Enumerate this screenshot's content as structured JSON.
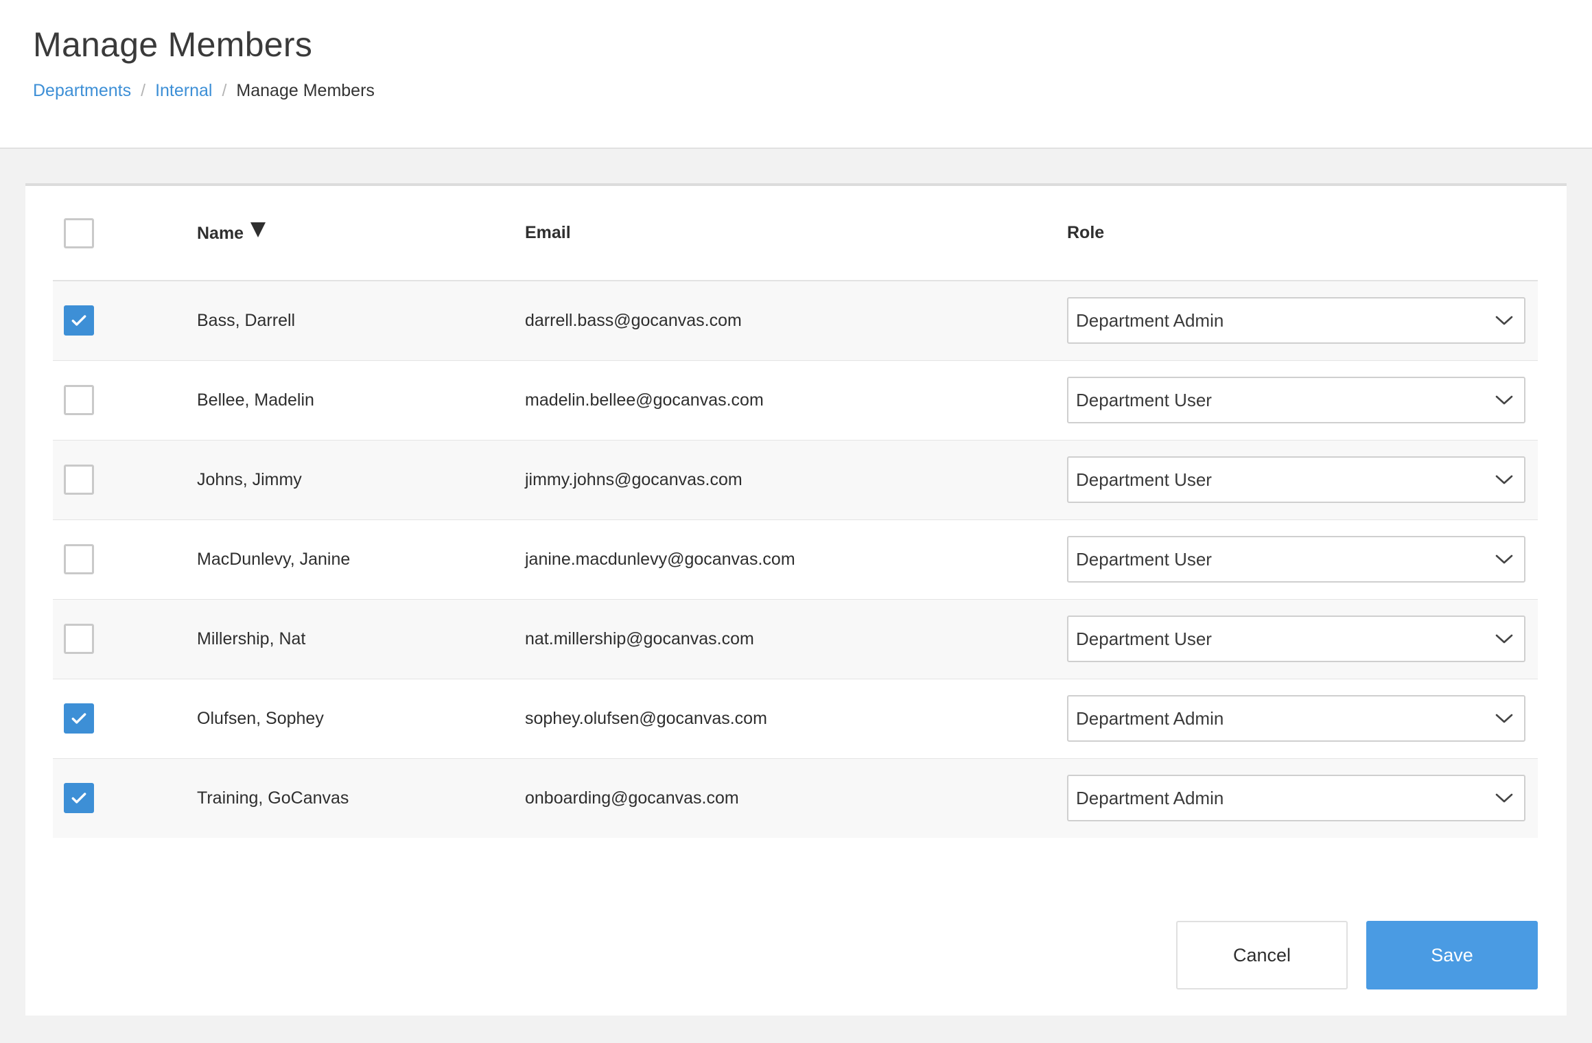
{
  "header": {
    "title": "Manage Members",
    "breadcrumb": [
      "Departments",
      "Internal",
      "Manage Members"
    ],
    "breadcrumb_separator": "/"
  },
  "table": {
    "columns": [
      "Name",
      "Email",
      "Role"
    ],
    "sorted_by": "Name",
    "select_all_checked": false,
    "rows": [
      {
        "checked": true,
        "name": "Bass, Darrell",
        "email": "darrell.bass@gocanvas.com",
        "role": "Department Admin"
      },
      {
        "checked": false,
        "name": "Bellee, Madelin",
        "email": "madelin.bellee@gocanvas.com",
        "role": "Department User"
      },
      {
        "checked": false,
        "name": "Johns, Jimmy",
        "email": "jimmy.johns@gocanvas.com",
        "role": "Department User"
      },
      {
        "checked": false,
        "name": "MacDunlevy, Janine",
        "email": "janine.macdunlevy@gocanvas.com",
        "role": "Department User"
      },
      {
        "checked": false,
        "name": "Millership, Nat",
        "email": "nat.millership@gocanvas.com",
        "role": "Department User"
      },
      {
        "checked": true,
        "name": "Olufsen, Sophey",
        "email": "sophey.olufsen@gocanvas.com",
        "role": "Department Admin"
      },
      {
        "checked": true,
        "name": "Training, GoCanvas",
        "email": "onboarding@gocanvas.com",
        "role": "Department Admin"
      }
    ]
  },
  "actions": {
    "cancel_label": "Cancel",
    "save_label": "Save"
  },
  "colors": {
    "accent": "#3d8fd6",
    "save_button": "#4a9be3",
    "page_background": "#f2f2f2"
  }
}
